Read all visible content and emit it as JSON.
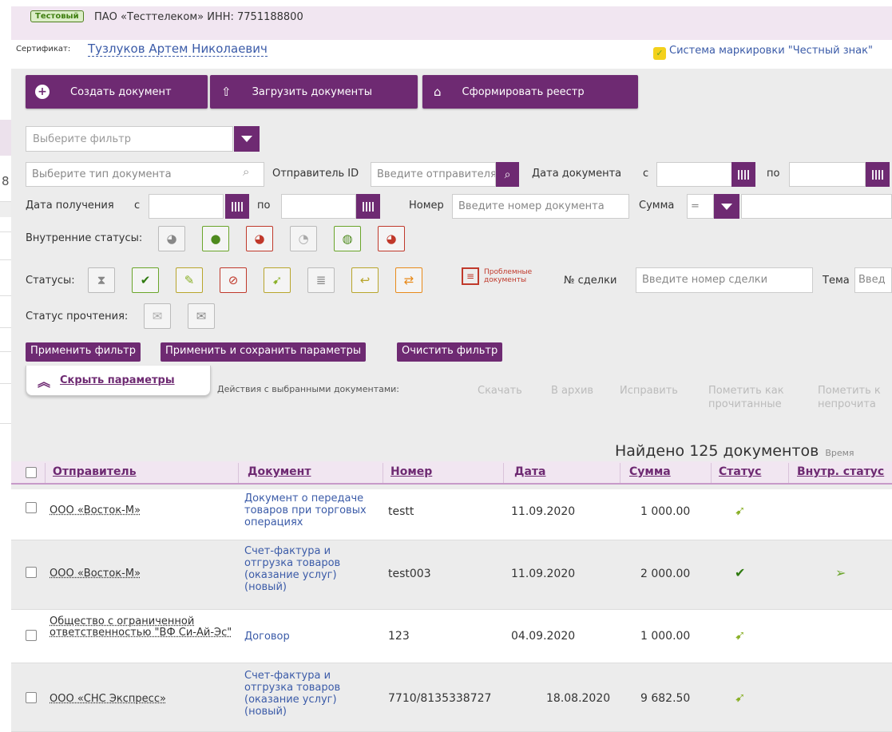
{
  "header": {
    "badge": "Тестовый",
    "org": "ПАО «Тесттелеком» ИНН: 7751188800",
    "cert_label": "Сертификат:",
    "cert_name": "Тузлуков Артем Николаевич",
    "marking_link": "Система маркировки \"Честный знак\""
  },
  "toolbar": {
    "create": "Создать документ",
    "upload": "Загрузить документы",
    "registry": "Сформировать реестр"
  },
  "filter": {
    "select_placeholder": "Выберите фильтр",
    "doc_type_placeholder": "Выберите тип документа",
    "sender_id_label": "Отправитель ID",
    "sender_id_placeholder": "Введите отправителя",
    "doc_date_label": "Дата документа",
    "from": "с",
    "to": "по",
    "recv_date_label": "Дата получения",
    "number_label": "Номер",
    "number_placeholder": "Введите номер документа",
    "sum_label": "Сумма",
    "sum_op": "=",
    "internal_statuses_label": "Внутренние статусы:",
    "statuses_label": "Статусы:",
    "problem_docs": "Проблемные документы",
    "deal_label": "№ сделки",
    "deal_placeholder": "Введите номер сделки",
    "topic_label": "Тема",
    "topic_placeholder": "Введ",
    "read_status_label": "Статус прочтения:",
    "apply": "Применить фильтр",
    "apply_save": "Применить и сохранить параметры",
    "clear": "Очистить фильтр",
    "hide_params": "Скрыть параметры"
  },
  "selection": {
    "label": "Действия с выбранными документами:",
    "download": "Скачать",
    "archive": "В архив",
    "fix": "Исправить",
    "mark_read": "Пометить как прочитанные",
    "mark_unread": "Пометить к непрочита"
  },
  "found": {
    "text": "Найдено 125 документов",
    "time": "Время"
  },
  "table": {
    "headers": {
      "sender": "Отправитель",
      "document": "Документ",
      "number": "Номер",
      "date": "Дата",
      "sum": "Сумма",
      "status": "Статус",
      "internal_status": "Внутр. статус"
    },
    "rows": [
      {
        "sender": "ООО «Восток-М»",
        "document": "Документ о передаче товаров при торговых операциях",
        "number": "testt",
        "date": "11.09.2020",
        "sum": "1 000.00",
        "status_icon": "sent-arrow-icon",
        "internal_icon": ""
      },
      {
        "sender": "ООО «Восток-М»",
        "document": "Счет-фактура и отгрузка товаров (оказание услуг) (новый)",
        "number": "test003",
        "date": "11.09.2020",
        "sum": "2 000.00",
        "status_icon": "check-icon",
        "internal_icon": "send-icon"
      },
      {
        "sender": "Общество с ограниченной ответственностью \"ВФ Си-Ай-Эс\"",
        "document": "Договор",
        "number": "123",
        "date": "04.09.2020",
        "sum": "1 000.00",
        "status_icon": "sent-arrow-icon",
        "internal_icon": ""
      },
      {
        "sender": "ООО «СНС Экспресс»",
        "document": "Счет-фактура и отгрузка товаров (оказание услуг) (новый)",
        "number": "7710/8135338727",
        "date": "18.08.2020",
        "sum": "9 682.50",
        "status_icon": "sent-arrow-icon",
        "internal_icon": ""
      }
    ]
  },
  "left_stub": {
    "digit": "8"
  },
  "colors": {
    "accent": "#6e2a72",
    "link": "#3b5ba8",
    "header_bg": "#f1e6f1",
    "panel_bg": "#ececec"
  }
}
